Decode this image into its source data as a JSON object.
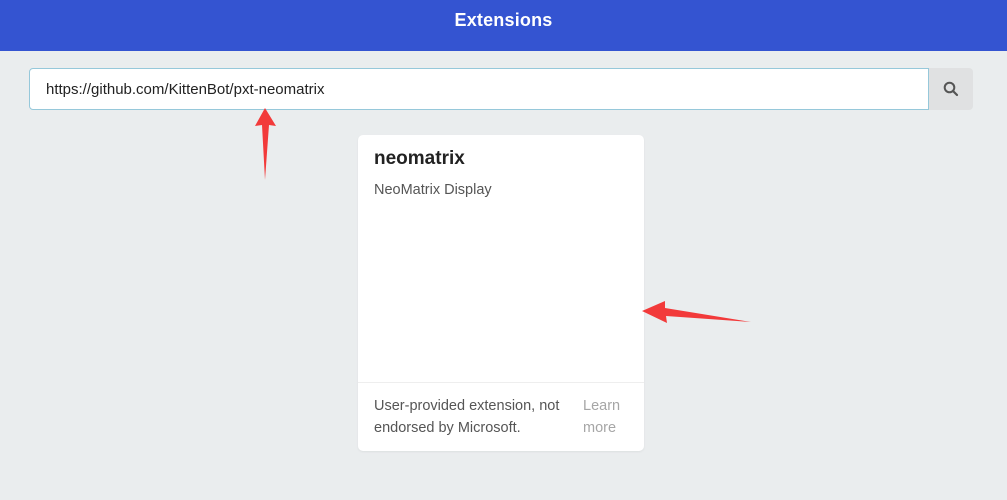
{
  "header": {
    "title": "Extensions"
  },
  "search": {
    "value": "https://github.com/KittenBot/pxt-neomatrix",
    "button_icon": "search-icon"
  },
  "card": {
    "title": "neomatrix",
    "description": "NeoMatrix Display",
    "footer_text": "User-provided extension, not endorsed by Microsoft.",
    "learn_more": "Learn more"
  },
  "annotations": {
    "arrow_color": "#f23a3a"
  },
  "colors": {
    "header_bg": "#3454d1",
    "page_bg": "#eaedee",
    "input_border": "#96c8da",
    "search_button_bg": "#e0e1e2"
  }
}
